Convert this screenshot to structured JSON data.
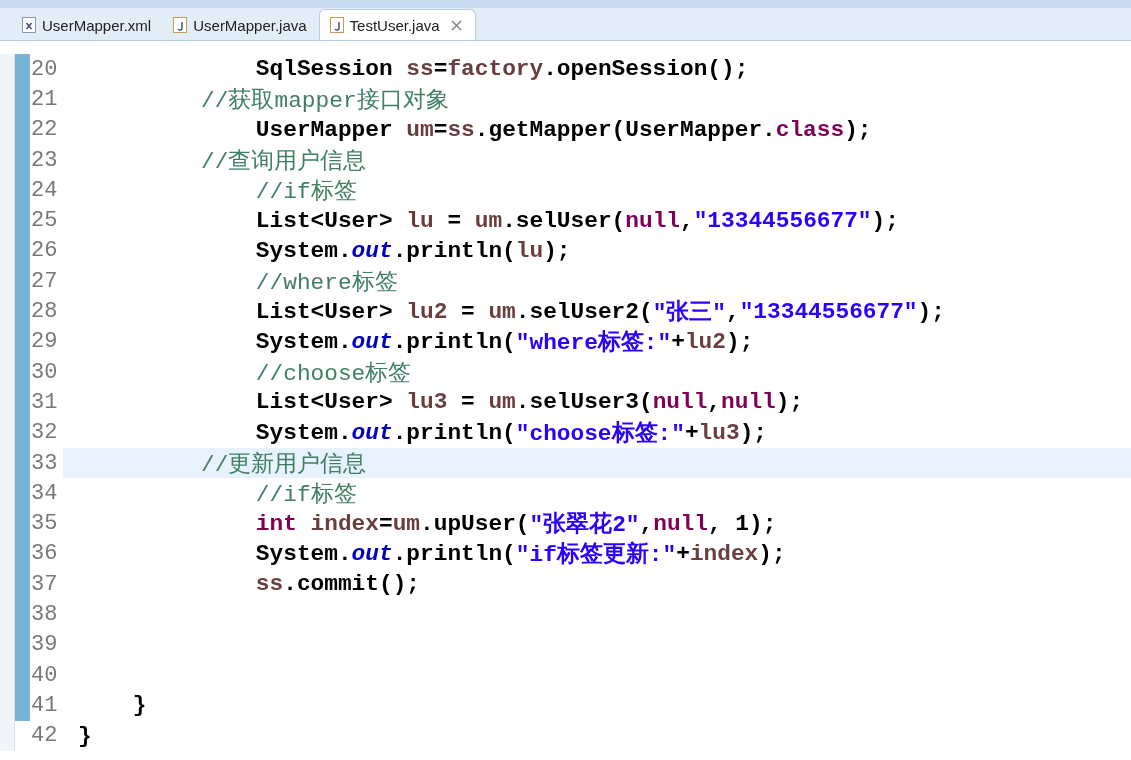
{
  "tabs": [
    {
      "label": "UserMapper.xml",
      "kind": "xml",
      "selected": false
    },
    {
      "label": "UserMapper.java",
      "kind": "java",
      "selected": false
    },
    {
      "label": "TestUser.java",
      "kind": "java",
      "selected": true
    }
  ],
  "editor": {
    "lines": [
      {
        "number": "20",
        "changed": true,
        "current": false,
        "tokens": [
          {
            "kind": "text",
            "text": "             SqlSession "
          },
          {
            "kind": "var",
            "text": "ss"
          },
          {
            "kind": "text",
            "text": "="
          },
          {
            "kind": "var",
            "text": "factory"
          },
          {
            "kind": "text",
            "text": ".openSession();"
          }
        ]
      },
      {
        "number": "21",
        "changed": true,
        "current": false,
        "tokens": [
          {
            "kind": "comment",
            "text": "         //获取mapper接口对象"
          }
        ]
      },
      {
        "number": "22",
        "changed": true,
        "current": false,
        "tokens": [
          {
            "kind": "text",
            "text": "             UserMapper "
          },
          {
            "kind": "var",
            "text": "um"
          },
          {
            "kind": "text",
            "text": "="
          },
          {
            "kind": "var",
            "text": "ss"
          },
          {
            "kind": "text",
            "text": ".getMapper(UserMapper."
          },
          {
            "kind": "keyword",
            "text": "class"
          },
          {
            "kind": "text",
            "text": ");"
          }
        ]
      },
      {
        "number": "23",
        "changed": true,
        "current": false,
        "tokens": [
          {
            "kind": "comment",
            "text": "         //查询用户信息"
          }
        ]
      },
      {
        "number": "24",
        "changed": true,
        "current": false,
        "tokens": [
          {
            "kind": "comment",
            "text": "             //if标签"
          }
        ]
      },
      {
        "number": "25",
        "changed": true,
        "current": false,
        "tokens": [
          {
            "kind": "text",
            "text": "             List<User> "
          },
          {
            "kind": "var",
            "text": "lu"
          },
          {
            "kind": "text",
            "text": " = "
          },
          {
            "kind": "var",
            "text": "um"
          },
          {
            "kind": "text",
            "text": ".selUser("
          },
          {
            "kind": "keyword",
            "text": "null"
          },
          {
            "kind": "text",
            "text": ","
          },
          {
            "kind": "string",
            "text": "\"13344556677\""
          },
          {
            "kind": "text",
            "text": ");"
          }
        ]
      },
      {
        "number": "26",
        "changed": true,
        "current": false,
        "tokens": [
          {
            "kind": "text",
            "text": "             System."
          },
          {
            "kind": "static",
            "text": "out"
          },
          {
            "kind": "text",
            "text": ".println("
          },
          {
            "kind": "var",
            "text": "lu"
          },
          {
            "kind": "text",
            "text": ");"
          }
        ]
      },
      {
        "number": "27",
        "changed": true,
        "current": false,
        "tokens": [
          {
            "kind": "comment",
            "text": "             //where标签"
          }
        ]
      },
      {
        "number": "28",
        "changed": true,
        "current": false,
        "tokens": [
          {
            "kind": "text",
            "text": "             List<User> "
          },
          {
            "kind": "var",
            "text": "lu2"
          },
          {
            "kind": "text",
            "text": " = "
          },
          {
            "kind": "var",
            "text": "um"
          },
          {
            "kind": "text",
            "text": ".selUser2("
          },
          {
            "kind": "string",
            "text": "\"张三\""
          },
          {
            "kind": "text",
            "text": ","
          },
          {
            "kind": "string",
            "text": "\"13344556677\""
          },
          {
            "kind": "text",
            "text": ");"
          }
        ]
      },
      {
        "number": "29",
        "changed": true,
        "current": false,
        "tokens": [
          {
            "kind": "text",
            "text": "             System."
          },
          {
            "kind": "static",
            "text": "out"
          },
          {
            "kind": "text",
            "text": ".println("
          },
          {
            "kind": "string",
            "text": "\"where标签:\""
          },
          {
            "kind": "text",
            "text": "+"
          },
          {
            "kind": "var",
            "text": "lu2"
          },
          {
            "kind": "text",
            "text": ");"
          }
        ]
      },
      {
        "number": "30",
        "changed": true,
        "current": false,
        "tokens": [
          {
            "kind": "comment",
            "text": "             //choose标签"
          }
        ]
      },
      {
        "number": "31",
        "changed": true,
        "current": false,
        "tokens": [
          {
            "kind": "text",
            "text": "             List<User> "
          },
          {
            "kind": "var",
            "text": "lu3"
          },
          {
            "kind": "text",
            "text": " = "
          },
          {
            "kind": "var",
            "text": "um"
          },
          {
            "kind": "text",
            "text": ".selUser3("
          },
          {
            "kind": "keyword",
            "text": "null"
          },
          {
            "kind": "text",
            "text": ","
          },
          {
            "kind": "keyword",
            "text": "null"
          },
          {
            "kind": "text",
            "text": ");"
          }
        ]
      },
      {
        "number": "32",
        "changed": true,
        "current": false,
        "tokens": [
          {
            "kind": "text",
            "text": "             System."
          },
          {
            "kind": "static",
            "text": "out"
          },
          {
            "kind": "text",
            "text": ".println("
          },
          {
            "kind": "string",
            "text": "\"choose标签:\""
          },
          {
            "kind": "text",
            "text": "+"
          },
          {
            "kind": "var",
            "text": "lu3"
          },
          {
            "kind": "text",
            "text": ");"
          }
        ]
      },
      {
        "number": "33",
        "changed": true,
        "current": true,
        "tokens": [
          {
            "kind": "comment",
            "text": "         //更新用户信息"
          }
        ]
      },
      {
        "number": "34",
        "changed": true,
        "current": false,
        "tokens": [
          {
            "kind": "comment",
            "text": "             //if标签"
          }
        ]
      },
      {
        "number": "35",
        "changed": true,
        "current": false,
        "tokens": [
          {
            "kind": "keyword",
            "text": "             int"
          },
          {
            "kind": "var",
            "text": " index"
          },
          {
            "kind": "text",
            "text": "="
          },
          {
            "kind": "var",
            "text": "um"
          },
          {
            "kind": "text",
            "text": ".upUser("
          },
          {
            "kind": "string",
            "text": "\"张翠花2\""
          },
          {
            "kind": "text",
            "text": ","
          },
          {
            "kind": "keyword",
            "text": "null"
          },
          {
            "kind": "text",
            "text": ", 1);"
          }
        ]
      },
      {
        "number": "36",
        "changed": true,
        "current": false,
        "tokens": [
          {
            "kind": "text",
            "text": "             System."
          },
          {
            "kind": "static",
            "text": "out"
          },
          {
            "kind": "text",
            "text": ".println("
          },
          {
            "kind": "string",
            "text": "\"if标签更新:\""
          },
          {
            "kind": "text",
            "text": "+"
          },
          {
            "kind": "var",
            "text": "index"
          },
          {
            "kind": "text",
            "text": ");"
          }
        ]
      },
      {
        "number": "37",
        "changed": true,
        "current": false,
        "tokens": [
          {
            "kind": "var",
            "text": "             ss"
          },
          {
            "kind": "text",
            "text": ".commit();"
          }
        ]
      },
      {
        "number": "38",
        "changed": true,
        "current": false
      },
      {
        "number": "39",
        "changed": true,
        "current": false
      },
      {
        "number": "40",
        "changed": true,
        "current": false
      },
      {
        "number": "41",
        "changed": true,
        "current": false,
        "tokens": [
          {
            "kind": "text",
            "text": "    }"
          }
        ]
      },
      {
        "number": "42",
        "changed": false,
        "current": false,
        "tokens": [
          {
            "kind": "text",
            "text": "}"
          }
        ]
      }
    ]
  }
}
